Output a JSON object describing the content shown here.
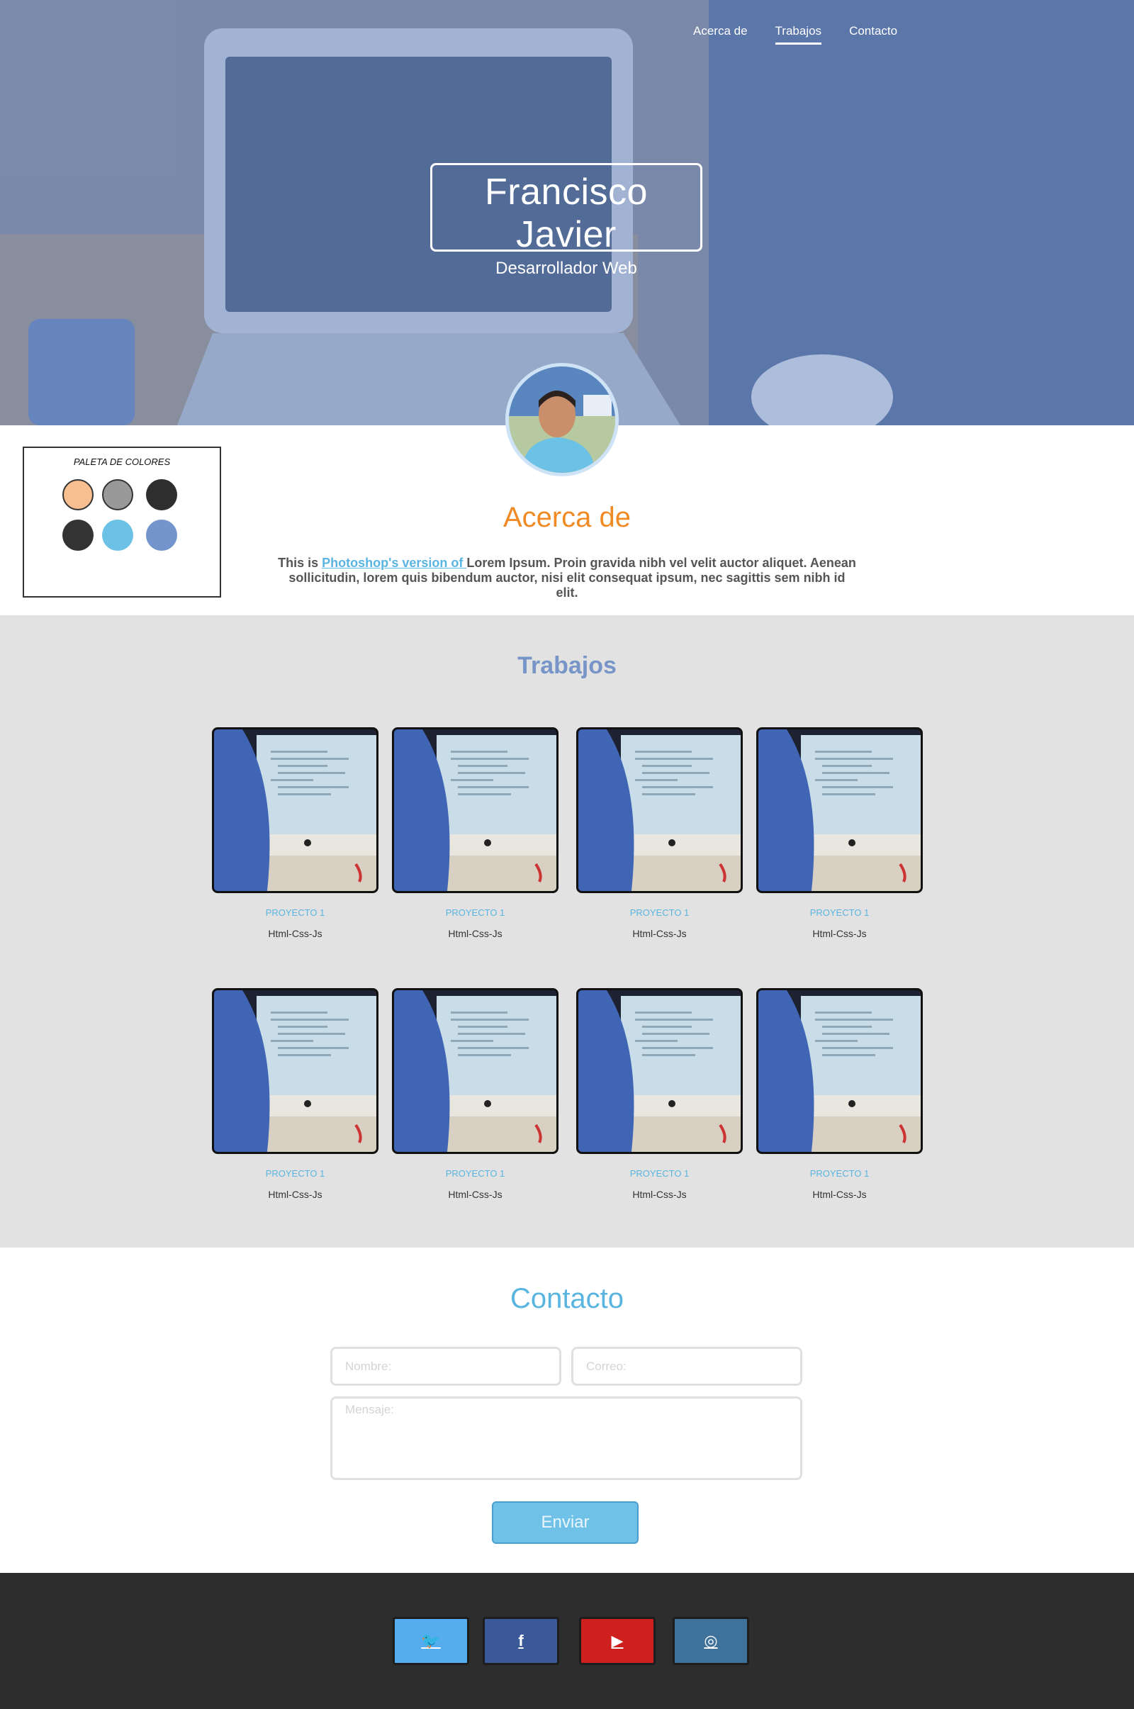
{
  "nav": {
    "items": [
      {
        "label": "Acerca de",
        "active": false
      },
      {
        "label": "Trabajos",
        "active": true
      },
      {
        "label": "Contacto",
        "active": false
      }
    ]
  },
  "hero": {
    "name": "Francisco Javier",
    "role": "Desarrollador Web"
  },
  "palette": {
    "title": "PALETA DE COLORES",
    "colors": [
      "#f7bf90",
      "#999999",
      "#2e2e2e",
      "#333333",
      "#6cc1e6",
      "#7394cc"
    ]
  },
  "about": {
    "title": "Acerca de",
    "text_before": "This is ",
    "link_text": "Photoshop's version  of ",
    "text_after": "Lorem Ipsum. Proin gravida nibh vel velit auctor aliquet. Aenean sollicitudin, lorem quis bibendum auctor, nisi elit consequat ipsum, nec sagittis sem nibh id elit."
  },
  "work": {
    "title": "Trabajos",
    "projects": [
      {
        "name": "PROYECTO 1",
        "tech": "Html-Css-Js"
      },
      {
        "name": "PROYECTO 1",
        "tech": "Html-Css-Js"
      },
      {
        "name": "PROYECTO 1",
        "tech": "Html-Css-Js"
      },
      {
        "name": "PROYECTO 1",
        "tech": "Html-Css-Js"
      },
      {
        "name": "PROYECTO 1",
        "tech": "Html-Css-Js"
      },
      {
        "name": "PROYECTO 1",
        "tech": "Html-Css-Js"
      },
      {
        "name": "PROYECTO 1",
        "tech": "Html-Css-Js"
      },
      {
        "name": "PROYECTO 1",
        "tech": "Html-Css-Js"
      }
    ]
  },
  "contact": {
    "title": "Contacto",
    "name_placeholder": "Nombre:",
    "email_placeholder": "Correo:",
    "message_placeholder": "Mensaje:",
    "send_label": "Enviar"
  },
  "footer": {
    "social": [
      {
        "icon": "twitter-icon",
        "glyph": "🐦",
        "color": "#55acee"
      },
      {
        "icon": "facebook-icon",
        "glyph": "f",
        "color": "#3b5998"
      },
      {
        "icon": "youtube-icon",
        "glyph": "▶",
        "color": "#cd201f"
      },
      {
        "icon": "instagram-icon",
        "glyph": "◎",
        "color": "#3f729b"
      }
    ]
  }
}
